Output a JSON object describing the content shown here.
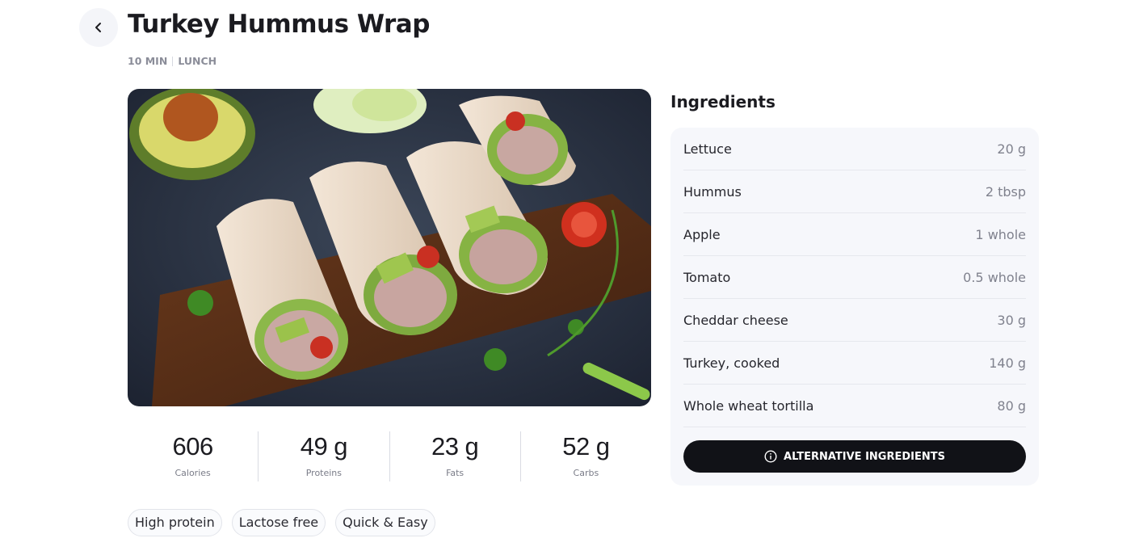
{
  "header": {
    "title": "Turkey Hummus Wrap",
    "duration": "10 MIN",
    "meal_type": "LUNCH",
    "back_icon": "chevron-left-icon"
  },
  "nutrition": [
    {
      "value": "606",
      "label": "Calories"
    },
    {
      "value": "49 g",
      "label": "Proteins"
    },
    {
      "value": "23 g",
      "label": "Fats"
    },
    {
      "value": "52 g",
      "label": "Carbs"
    }
  ],
  "tags": [
    "High protein",
    "Lactose free",
    "Quick & Easy"
  ],
  "ingredients": {
    "title": "Ingredients",
    "items": [
      {
        "name": "Lettuce",
        "qty": "20 g"
      },
      {
        "name": "Hummus",
        "qty": "2 tbsp"
      },
      {
        "name": "Apple",
        "qty": "1 whole"
      },
      {
        "name": "Tomato",
        "qty": "0.5 whole"
      },
      {
        "name": "Cheddar cheese",
        "qty": "30 g"
      },
      {
        "name": "Turkey, cooked",
        "qty": "140 g"
      },
      {
        "name": "Whole wheat tortilla",
        "qty": "80 g"
      }
    ],
    "alt_button_label": "ALTERNATIVE INGREDIENTS",
    "alt_button_icon": "info-icon"
  },
  "colors": {
    "accent": "#111217",
    "muted_text": "#8b8d99",
    "card_bg": "#f6f7fb"
  }
}
